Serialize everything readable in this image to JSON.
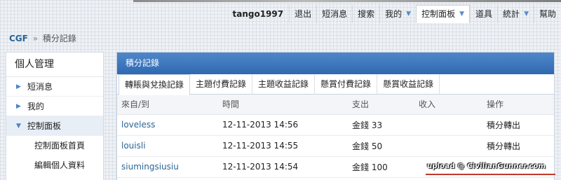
{
  "topnav": {
    "username": "tango1997",
    "items": [
      {
        "label": "退出"
      },
      {
        "label": "短消息"
      },
      {
        "label": "搜索"
      },
      {
        "label": "我的"
      },
      {
        "label": "控制面板"
      },
      {
        "label": "道具"
      },
      {
        "label": "統計"
      },
      {
        "label": "幫助"
      }
    ]
  },
  "breadcrumb": {
    "home": "CGF",
    "separator": "»",
    "current": "積分記錄"
  },
  "sidebar": {
    "title": "個人管理",
    "items": [
      {
        "label": "短消息"
      },
      {
        "label": "我的"
      },
      {
        "label": "控制面板"
      }
    ],
    "subitems": [
      {
        "label": "控制面板首頁"
      },
      {
        "label": "編輯個人資料"
      }
    ]
  },
  "panel": {
    "title": "積分記錄",
    "tabs": [
      {
        "label": "轉賬與兌換記錄"
      },
      {
        "label": "主題付費記錄"
      },
      {
        "label": "主題收益記錄"
      },
      {
        "label": "懸賞付費記錄"
      },
      {
        "label": "懸賞收益記錄"
      }
    ],
    "columns": [
      "來自/到",
      "時間",
      "支出",
      "收入",
      "操作"
    ],
    "rows": [
      {
        "user": "loveless",
        "time": "12-11-2013 14:56",
        "expense": "金錢 33",
        "income": "",
        "action": "積分轉出"
      },
      {
        "user": "louisli",
        "time": "12-11-2013 14:55",
        "expense": "金錢 50",
        "income": "",
        "action": "積分轉出"
      },
      {
        "user": "siumingsiusiu",
        "time": "12-11-2013 14:54",
        "expense": "金錢 100",
        "income": "",
        "action": ""
      }
    ]
  },
  "watermark": "upload @ CivilianGunner.com",
  "colors": {
    "accent": "#2f69b1",
    "link": "#2a6496"
  }
}
